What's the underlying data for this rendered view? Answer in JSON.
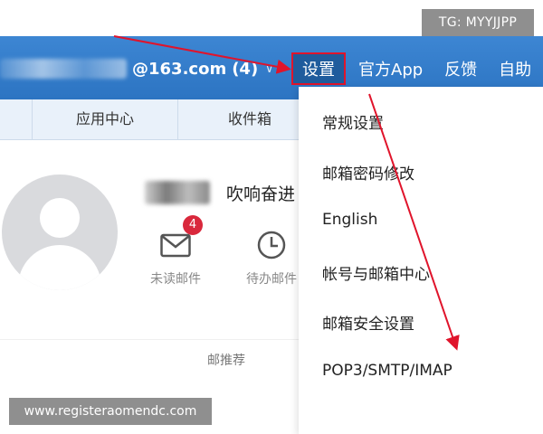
{
  "watermarks": {
    "tg": "TG: MYYJJPP",
    "url": "www.registeraomendc.com"
  },
  "header": {
    "account_email": "@163.com",
    "unread_count": "(4)",
    "nav": [
      {
        "label": "设置",
        "active": true
      },
      {
        "label": "官方App"
      },
      {
        "label": "反馈"
      },
      {
        "label": "自助"
      }
    ]
  },
  "tabs": [
    {
      "label": "应用中心"
    },
    {
      "label": "收件箱"
    }
  ],
  "profile": {
    "greeting": "吹响奋进",
    "stats": [
      {
        "label": "未读邮件",
        "icon": "envelope-icon",
        "badge": "4"
      },
      {
        "label": "待办邮件",
        "icon": "clock-icon"
      }
    ],
    "recommend": "邮推荐"
  },
  "settings_menu": [
    {
      "label": "常规设置"
    },
    {
      "label": "邮箱密码修改"
    },
    {
      "label": "English"
    },
    {
      "label": "帐号与邮箱中心"
    },
    {
      "label": "邮箱安全设置"
    },
    {
      "label": "POP3/SMTP/IMAP"
    }
  ],
  "colors": {
    "header_blue": "#2c74c2",
    "annotation_red": "#e0142b",
    "badge_red": "#d9283c"
  }
}
